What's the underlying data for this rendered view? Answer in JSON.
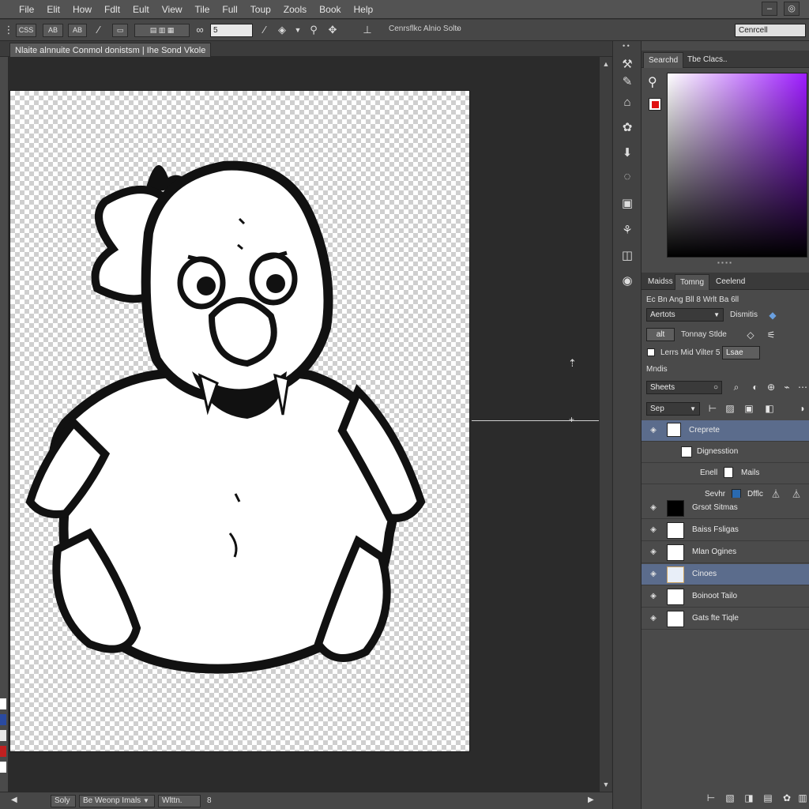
{
  "menu": [
    "File",
    "Elit",
    "How",
    "Fdlt",
    "Eult",
    "View",
    "Tile",
    "Full",
    "Toup",
    "Zools",
    "Book",
    "Help"
  ],
  "options": {
    "btn1": "CSS",
    "btn2": "AB",
    "btn3": "AB",
    "size_value": "5",
    "breadcrumb": "Cenrsflkc Alnio Solto",
    "workspace": "Cenrcell"
  },
  "document": {
    "tab_title": "Nlaite alnnuite Conmol donistsm",
    "tab_subtitle": "Ihe Sond Vkole"
  },
  "status": {
    "zoom": "Soly",
    "info": "Be Weonp Imals",
    "info2": "Wlttn.",
    "page": "8"
  },
  "color_panel": {
    "tabs": [
      "Searchd",
      "Tbe Clacs.."
    ],
    "fg_color": "#e01010"
  },
  "props_panel": {
    "tabs": [
      "Maidss",
      "Tomng",
      "Ceelend"
    ],
    "header_row": "Ec Bn Ang Bll 8 Wrlt Ba 6ll",
    "select1": "Aertots",
    "label_dismiss": "Dismitis",
    "btn_alt": "alt",
    "toning": "Tonnay Stlde",
    "checkbox_label": "Lerrs Mid Vilter 5",
    "checkbox_value": "Lsae",
    "section_label": "Mndis",
    "search_value": "Sheets",
    "blend_select": "Sep"
  },
  "layers_top": [
    {
      "name": "Creprete",
      "selected": true
    },
    {
      "name": "Dignesstion",
      "selected": false
    }
  ],
  "layers_sub": {
    "label": "Enell",
    "name": "Mails",
    "row2_label": "Sevhr",
    "row2_name": "Dfflc"
  },
  "layers": [
    {
      "name": "Grsot Sitmas",
      "thumb": "#000000",
      "selected": false
    },
    {
      "name": "Baiss Fsligas",
      "thumb": "#ffffff",
      "selected": false
    },
    {
      "name": "Mlan Ogines",
      "thumb": "#ffffff",
      "selected": false
    },
    {
      "name": "Cinoes",
      "thumb": "#e8eef8",
      "selected": true
    },
    {
      "name": "Boinoot Tailo",
      "thumb": "#ffffff",
      "selected": false
    },
    {
      "name": "Gats fte Tiqle",
      "thumb": "#ffffff",
      "selected": false
    }
  ]
}
